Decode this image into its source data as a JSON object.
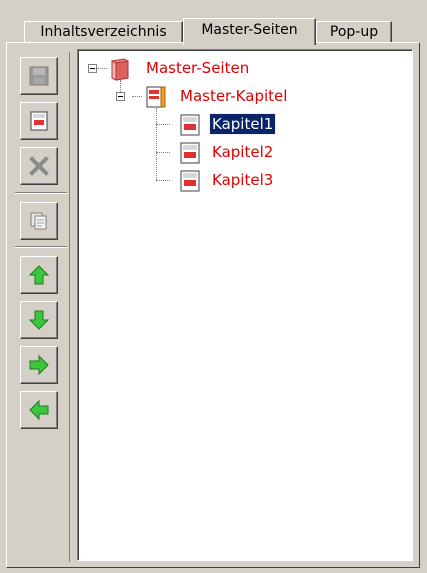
{
  "tabs": [
    {
      "label": "Inhaltsverzeichnis",
      "active": false
    },
    {
      "label": "Master-Seiten",
      "active": true
    },
    {
      "label": "Pop-up",
      "active": false
    }
  ],
  "toolbar": {
    "buttons": [
      {
        "icon": "save-disk-icon",
        "enabled": false
      },
      {
        "icon": "page-icon",
        "enabled": true
      },
      {
        "icon": "delete-x-icon",
        "enabled": false
      },
      {
        "icon": "copy-pages-icon",
        "enabled": true
      },
      {
        "icon": "arrow-up-icon",
        "enabled": true
      },
      {
        "icon": "arrow-down-icon",
        "enabled": true
      },
      {
        "icon": "arrow-right-icon",
        "enabled": true
      },
      {
        "icon": "arrow-left-icon",
        "enabled": true
      }
    ]
  },
  "tree": {
    "root": {
      "label": "Master-Seiten",
      "icon": "book-icon",
      "expanded": true
    },
    "chapter": {
      "label": "Master-Kapitel",
      "icon": "chapter-icon",
      "expanded": true
    },
    "pages": [
      {
        "label": "Kapitel1",
        "icon": "page-icon",
        "selected": true
      },
      {
        "label": "Kapitel2",
        "icon": "page-icon",
        "selected": false
      },
      {
        "label": "Kapitel3",
        "icon": "page-icon",
        "selected": false
      }
    ]
  },
  "colors": {
    "accent_label": "#e00000",
    "selection": "#0a246a",
    "arrow_green": "#3cc63c",
    "window_bg": "#d4d0c8"
  }
}
